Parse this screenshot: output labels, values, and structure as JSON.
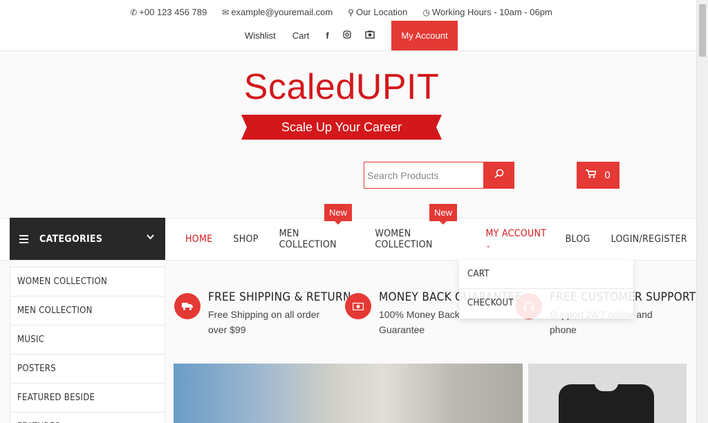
{
  "topbar": {
    "phone": "+00 123 456 789",
    "email": "example@youremail.com",
    "location": "Our Location",
    "hours": "Working Hours - 10am - 06pm",
    "wishlist": "Wishlist",
    "cart": "Cart",
    "account": "My Account",
    "social": [
      "facebook-icon",
      "instagram-icon",
      "camera-icon"
    ]
  },
  "brand": {
    "name": "ScaledUPIT",
    "tagline": "Scale Up Your Career"
  },
  "search": {
    "placeholder": "Search Products"
  },
  "cart": {
    "count": "0"
  },
  "categories": {
    "label": "CATEGORIES",
    "items": [
      "WOMEN COLLECTION",
      "MEN COLLECTION",
      "MUSIC",
      "POSTERS",
      "FEATURED BESIDE"
    ]
  },
  "nav": {
    "items": [
      "HOME",
      "SHOP",
      "MEN COLLECTION",
      "WOMEN COLLECTION",
      "MY ACCOUNT",
      "BLOG",
      "LOGIN/REGISTER"
    ],
    "badge": "New",
    "active": "HOME"
  },
  "dropdown": {
    "items": [
      "CART",
      "CHECKOUT"
    ]
  },
  "features": [
    {
      "title": "FREE SHIPPING & RETURN",
      "line1": "Free Shipping on all order",
      "line2": "over $99",
      "icon": "truck-icon"
    },
    {
      "title": "MONEY BACK GUARANTEE",
      "line1": "100% Money Back",
      "line2": "Guarantee",
      "icon": "money-icon"
    },
    {
      "title": "FREE CUSTOMER SUPPORT",
      "line1": "Support 24/7 online and",
      "line2": "phone",
      "icon": "support-icon"
    }
  ],
  "colors": {
    "accent": "#e53935",
    "brand_red": "#d3181c",
    "dark": "#282828"
  }
}
